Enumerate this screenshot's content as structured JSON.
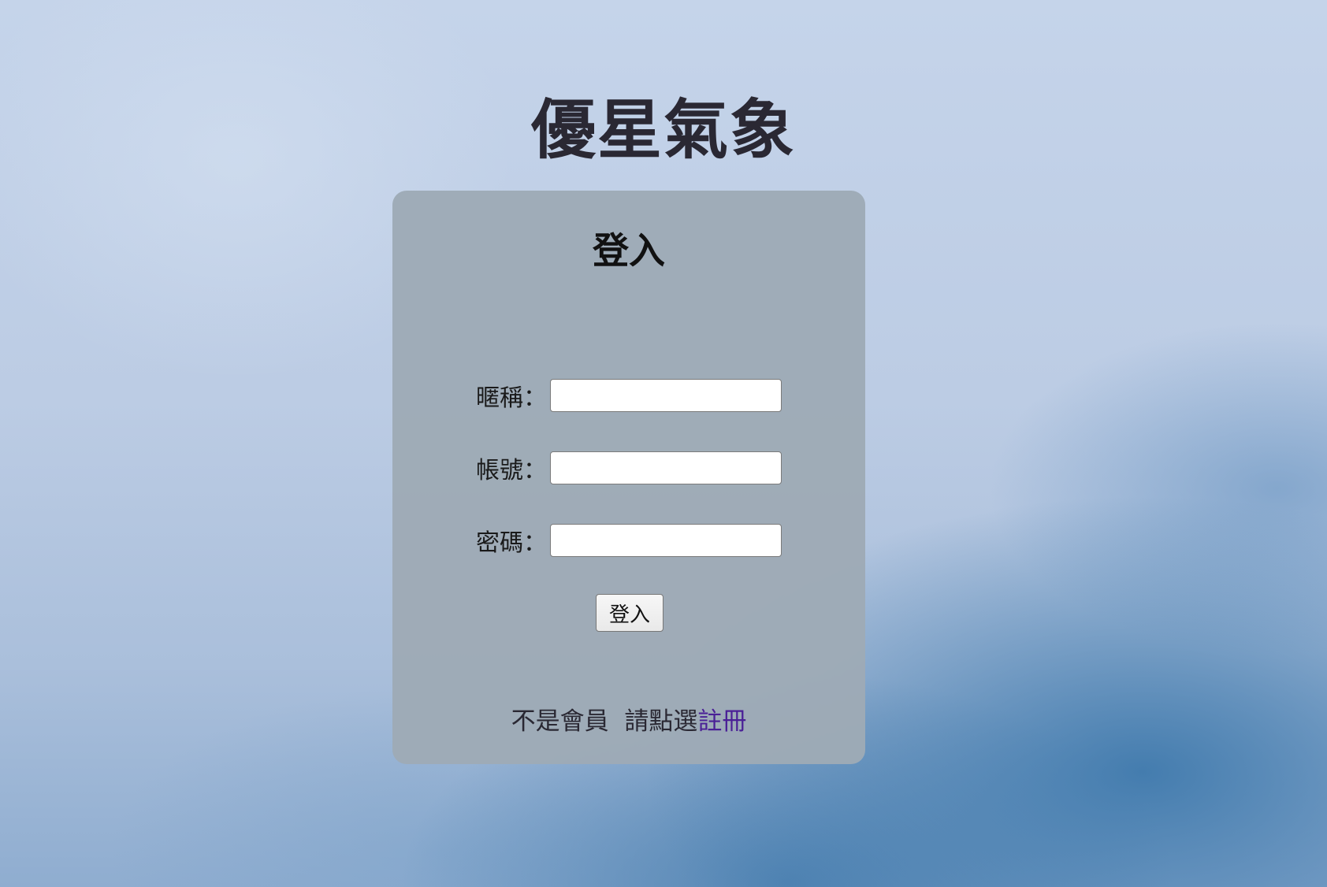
{
  "site": {
    "title": "優星氣象"
  },
  "login_card": {
    "title": "登入",
    "fields": [
      {
        "label": "暱稱：",
        "value": "",
        "placeholder": ""
      },
      {
        "label": "帳號：",
        "value": "",
        "placeholder": ""
      },
      {
        "label": "密碼：",
        "value": "",
        "placeholder": ""
      }
    ],
    "submit_label": "登入",
    "register_prompt": "不是會員  請點選",
    "register_link": "註冊"
  },
  "colors": {
    "title_text": "#2a2833",
    "card_background": "#9eaab6",
    "register_link": "#4a1f96"
  }
}
